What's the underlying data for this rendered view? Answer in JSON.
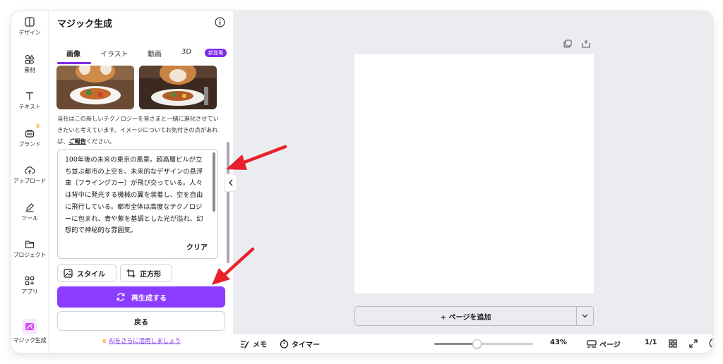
{
  "sidebar": {
    "items": [
      {
        "label": "デザイン",
        "icon": "layout-icon"
      },
      {
        "label": "素材",
        "icon": "shapes-icon"
      },
      {
        "label": "テキスト",
        "icon": "text-icon"
      },
      {
        "label": "ブランド",
        "icon": "brand-icon"
      },
      {
        "label": "アップロード",
        "icon": "cloud-upload-icon"
      },
      {
        "label": "ツール",
        "icon": "pen-tool-icon"
      },
      {
        "label": "プロジェクト",
        "icon": "folder-icon"
      },
      {
        "label": "アプリ",
        "icon": "apps-icon"
      },
      {
        "label": "マジック生成",
        "icon": "magic-icon"
      }
    ]
  },
  "panel": {
    "title": "マジック生成",
    "tabs": [
      "画像",
      "イラスト",
      "動画",
      "3D"
    ],
    "new_badge": "新登場",
    "description_1": "当社はこの新しいテクノロジーを皆さまと一緒に進化させていきたいと考えています。イメージについてお気付きの点があれば、",
    "description_link": "ご報告",
    "description_2": "ください。",
    "prompt": "100年後の未来の東京の風景。超高層ビルが立ち並ぶ都市の上空を、未来的なデザインの悬浮車（フライングカー）が飛び交っている。人々は背中に発光する機械の翼を装着し、空を自由に飛行している。都市全体は高度なテクノロジーに包まれ、青や紫を基調とした光が溢れ、幻想的で神秘的な雰囲気。",
    "clear_label": "クリア",
    "style_label": "スタイル",
    "ratio_label": "正方形",
    "regenerate_label": "再生成する",
    "back_label": "戻る",
    "ai_link": "AIをさらに活用しましょう"
  },
  "bottom": {
    "memo": "メモ",
    "timer": "タイマー",
    "zoom": "43%",
    "zoom_fraction": 0.43,
    "pages": "ページ",
    "page_count": "1/1"
  },
  "canvas": {
    "add_page": "+ ページを追加"
  },
  "colors": {
    "accent": "#8b3dff",
    "arrow": "#e8202a"
  }
}
